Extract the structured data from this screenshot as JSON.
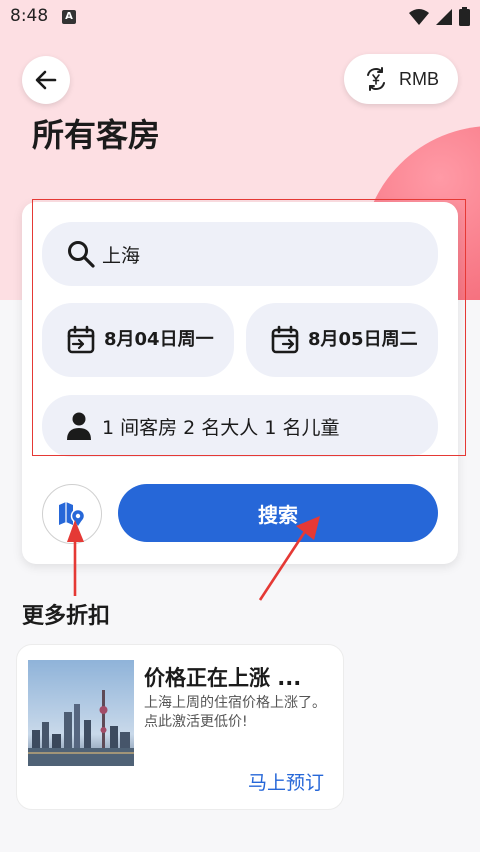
{
  "status_bar": {
    "time": "8:48",
    "notification_badge": "A"
  },
  "header": {
    "currency_label": "RMB",
    "title": "所有客房"
  },
  "search_form": {
    "destination": "上海",
    "check_in": "8月04日周一",
    "check_out": "8月05日周二",
    "guests": "1 间客房 2 名大人 1 名儿童",
    "search_button_label": "搜索"
  },
  "section": {
    "title": "更多折扣"
  },
  "deal": {
    "title": "价格正在上涨 ...",
    "description": "上海上周的住宿价格上涨了。点此激活更低价!",
    "link_label": "马上预订"
  },
  "colors": {
    "accent": "#2667d8",
    "hero_bg": "#fddfe3",
    "highlight_box": "#e53935",
    "annotation_arrow": "#e53935"
  },
  "icons": [
    "back-arrow-icon",
    "currency-exchange-icon",
    "search-icon",
    "calendar-checkin-icon",
    "calendar-checkout-icon",
    "person-icon",
    "map-pin-icon",
    "wifi-icon",
    "signal-icon",
    "battery-icon"
  ]
}
